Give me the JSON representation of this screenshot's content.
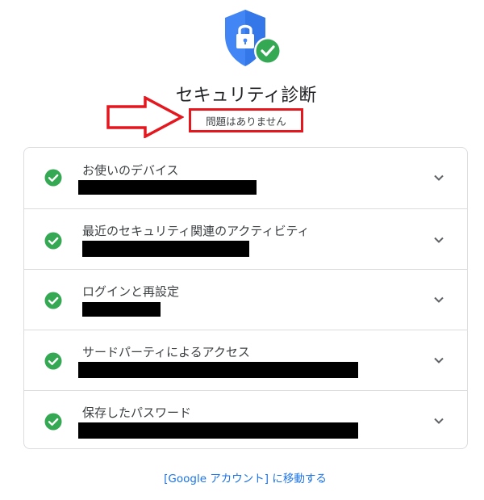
{
  "header": {
    "icon": "shield-lock-check-icon",
    "title": "セキュリティ診断",
    "status": "問題はありません"
  },
  "annotation": {
    "arrow_color": "#e4161e",
    "box_color": "#e4161e"
  },
  "colors": {
    "shield_blue": "#4285f4",
    "check_green": "#34a853",
    "link_blue": "#1a73e8"
  },
  "sections": [
    {
      "title": "お使いのデバイス",
      "status_icon": "check-circle-icon",
      "expand_icon": "chevron-down-icon"
    },
    {
      "title": "最近のセキュリティ関連のアクティビティ",
      "status_icon": "check-circle-icon",
      "expand_icon": "chevron-down-icon"
    },
    {
      "title": "ログインと再設定",
      "status_icon": "check-circle-icon",
      "expand_icon": "chevron-down-icon"
    },
    {
      "title": "サードパーティによるアクセス",
      "status_icon": "check-circle-icon",
      "expand_icon": "chevron-down-icon"
    },
    {
      "title": "保存したパスワード",
      "status_icon": "check-circle-icon",
      "expand_icon": "chevron-down-icon"
    }
  ],
  "footer": {
    "link": "[Google アカウント] に移動する"
  }
}
